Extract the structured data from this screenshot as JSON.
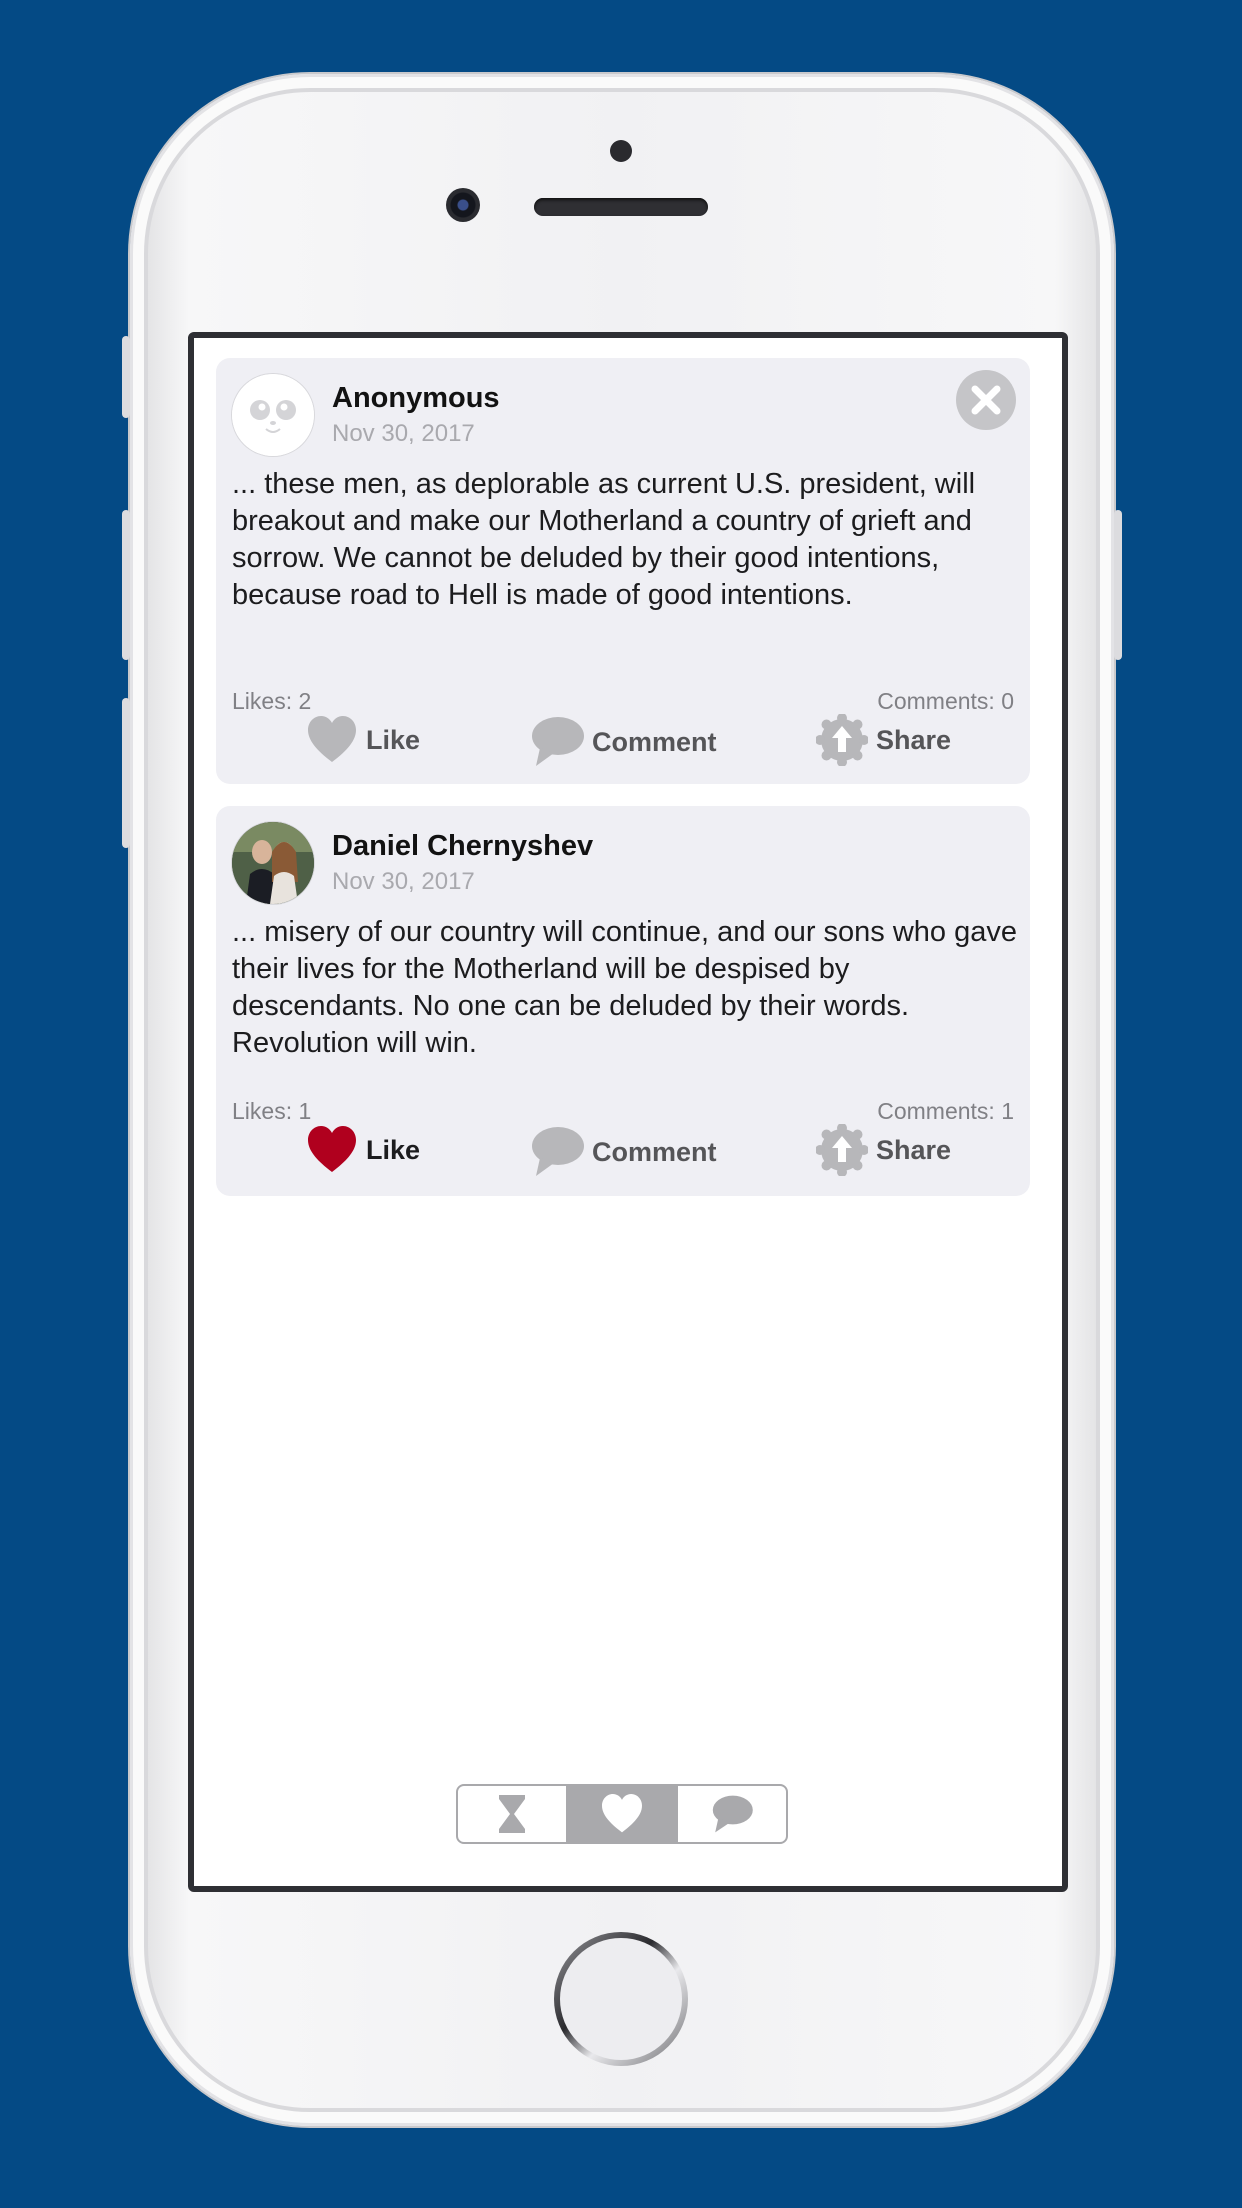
{
  "feed": {
    "posts": [
      {
        "author": "Anonymous",
        "date": "Nov 30, 2017",
        "text": "... these men, as deplorable as current U.S. president, will breakout and make our Motherland a country of grieft and sorrow. We cannot be deluded by their good intentions, because road to Hell is made of good intentions.",
        "likes": "Likes: 2",
        "comments": "Comments: 0",
        "liked": false
      },
      {
        "author": "Daniel Chernyshev",
        "date": "Nov 30, 2017",
        "text": "... misery of our country will continue, and our sons who gave their lives for the Motherland will be despised by descendants. No one can be deluded by their words. Revolution will win.",
        "likes": "Likes: 1",
        "comments": "Comments: 1",
        "liked": true
      }
    ]
  },
  "actions": {
    "like": "Like",
    "comment": "Comment",
    "share": "Share"
  },
  "tabs": [
    {
      "icon": "hourglass-icon",
      "active": false
    },
    {
      "icon": "heart-icon",
      "active": true
    },
    {
      "icon": "speech-bubble-icon",
      "active": false
    }
  ],
  "colors": {
    "background": "#044a85",
    "liked_heart": "#b0001e",
    "icon_gray": "#b7b7ba",
    "card": "#efeff4"
  }
}
